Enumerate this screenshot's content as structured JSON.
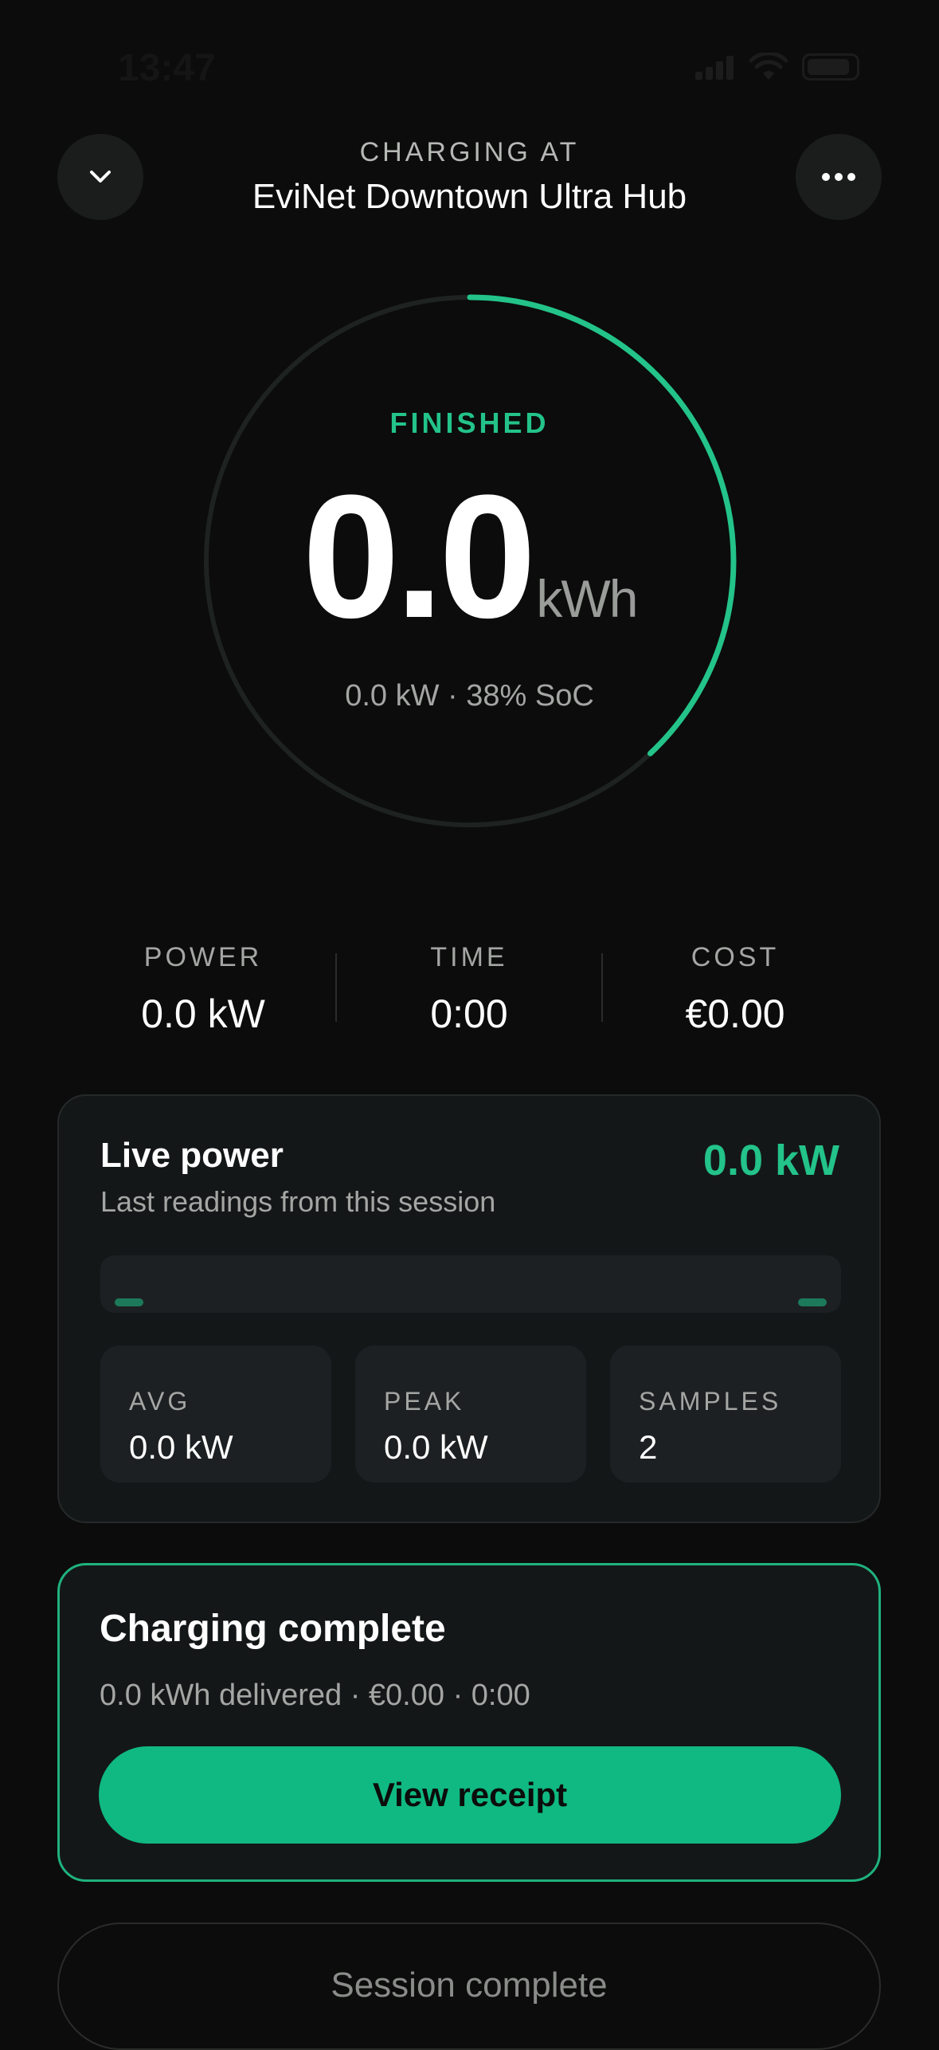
{
  "status_bar": {
    "time": "13:47"
  },
  "header": {
    "label": "CHARGING AT",
    "station": "EviNet Downtown Ultra Hub",
    "back_icon": "chevron-down-icon",
    "menu_icon": "more-horizontal-icon"
  },
  "ring": {
    "status": "FINISHED",
    "energy_value": "0.0",
    "energy_unit": "kWh",
    "subtitle": "0.0 kW · 38% SoC",
    "progress_fraction": 0.38,
    "accent_color": "#23c38a"
  },
  "stats": [
    {
      "label": "POWER",
      "value": "0.0 kW"
    },
    {
      "label": "TIME",
      "value": "0:00"
    },
    {
      "label": "COST",
      "value": "€0.00"
    }
  ],
  "live_power": {
    "title": "Live power",
    "subtitle": "Last readings from this session",
    "current": "0.0 kW",
    "metrics": [
      {
        "label": "AVG",
        "value": "0.0 kW"
      },
      {
        "label": "PEAK",
        "value": "0.0 kW"
      },
      {
        "label": "SAMPLES",
        "value": "2"
      }
    ]
  },
  "complete": {
    "title": "Charging complete",
    "summary": "0.0 kWh delivered · €0.00 · 0:00",
    "button": "View receipt",
    "button_color": "#10b981"
  },
  "footer": {
    "session_label": "Session complete"
  }
}
